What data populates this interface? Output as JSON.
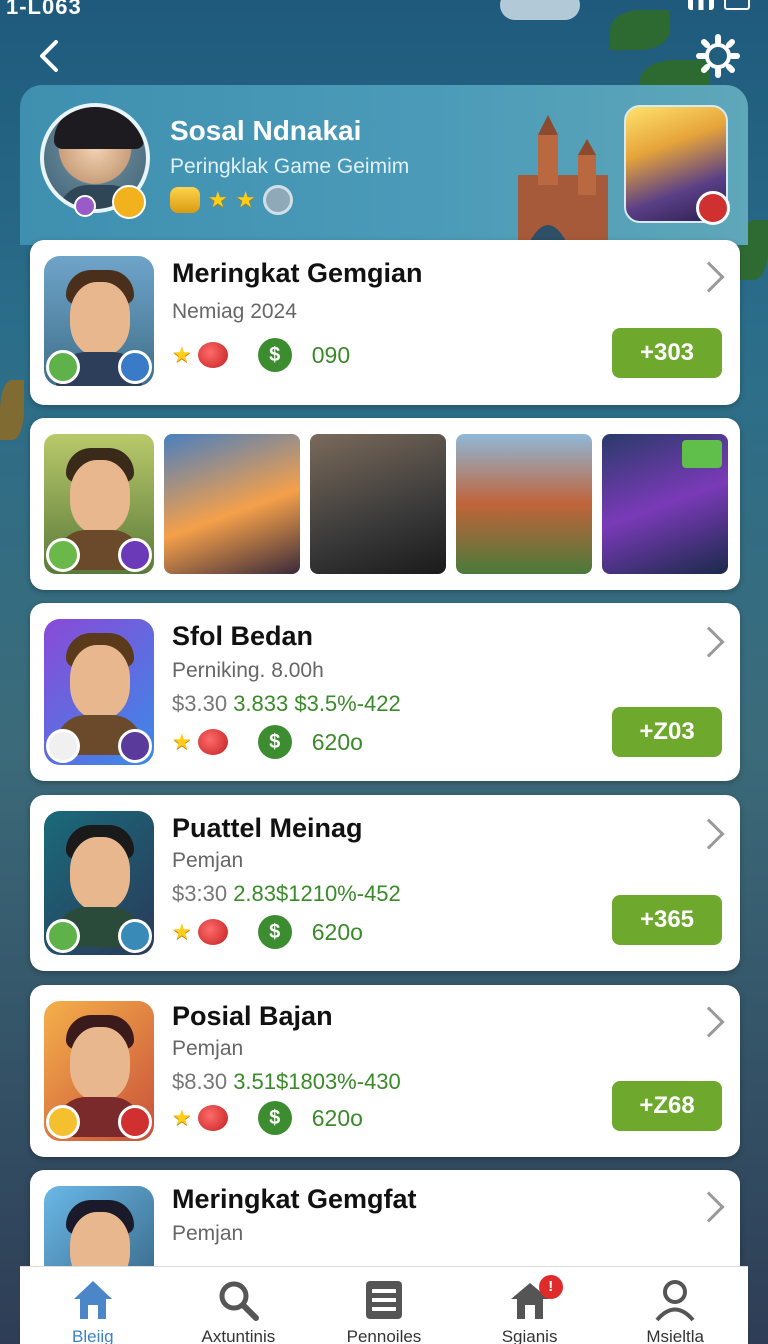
{
  "status_bar": {
    "time": "1-L063"
  },
  "header": {
    "title": "Sosal Ndnakai",
    "subtitle": "Peringklak Game Geimim"
  },
  "cards": [
    {
      "title": "Meringkat Gemgian",
      "subtitle": "Nemiag 2024",
      "stats_prefix": "",
      "stats_value": "",
      "row_value": "090",
      "button": "+303"
    },
    {
      "title": "Sfol Bedan",
      "subtitle": "Perniking. 8.00h",
      "stats_prefix": "$3.30",
      "stats_value": "3.833 $3.5%-422",
      "row_value": "620o",
      "button": "+Z03"
    },
    {
      "title": "Puattel Meinag",
      "subtitle": "Pemjan",
      "stats_prefix": "$3:30",
      "stats_value": "2.83$1210%-452",
      "row_value": "620o",
      "button": "+365"
    },
    {
      "title": "Posial Bajan",
      "subtitle": "Pemjan",
      "stats_prefix": "$8.30",
      "stats_value": "3.51$1803%-430",
      "row_value": "620o",
      "button": "+Z68"
    },
    {
      "title": "Meringkat Gemgfat",
      "subtitle": "Pemjan"
    }
  ],
  "dollar_symbol": "$",
  "bottom_nav": [
    {
      "label": "Bleiig",
      "icon": "home-icon"
    },
    {
      "label": "Axtuntinis",
      "icon": "search-icon"
    },
    {
      "label": "Pennoiles",
      "icon": "list-icon"
    },
    {
      "label": "Sgianis",
      "icon": "house-alert-icon",
      "badge": "!"
    },
    {
      "label": "Msieltla",
      "icon": "profile-icon"
    }
  ],
  "colors": {
    "accent_green": "#6ea92e",
    "nav_active": "#3d82c4",
    "header_blue": "#4a9ab8"
  }
}
